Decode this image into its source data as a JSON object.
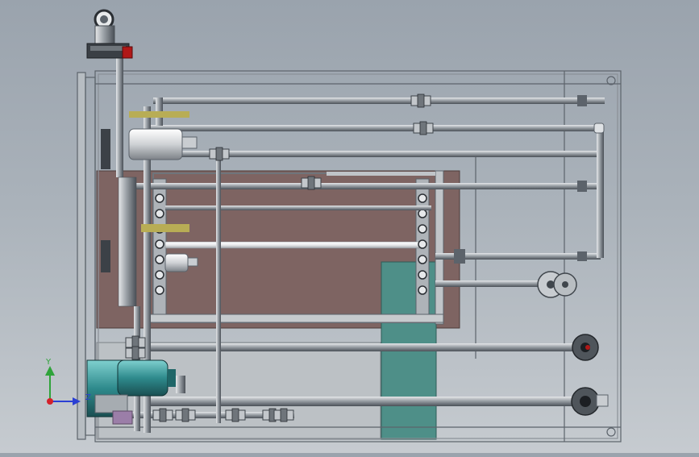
{
  "viewport": {
    "background_top": "#9aa3ad",
    "background_bottom": "#c6cbd0",
    "view_description_hidden": ""
  },
  "triad": {
    "x_label": "X",
    "y_label": "Y",
    "z_label": "Z",
    "x_color": "#d4202a",
    "y_color": "#2fa33a",
    "z_color": "#2a3fd4"
  },
  "colors": {
    "frame": "#5c636b",
    "pipe_dark": "#6f757b",
    "pipe_light": "#c9cdd1",
    "panel_brown": "#7e6462",
    "panel_teal": "#4e8f88",
    "panel_grey": "#bcc1c5",
    "pump_teal": "#2e8a8c",
    "valve_red": "#b01818",
    "brass": "#b8ad55"
  },
  "components": {
    "inlet_elbow": "inlet-elbow",
    "main_pump": "centrifugal-pump",
    "motor": "drive-motor",
    "heat_exchanger": "tube-bundle-exchanger",
    "flanges": [
      "flange-1",
      "flange-2",
      "flange-3"
    ]
  }
}
